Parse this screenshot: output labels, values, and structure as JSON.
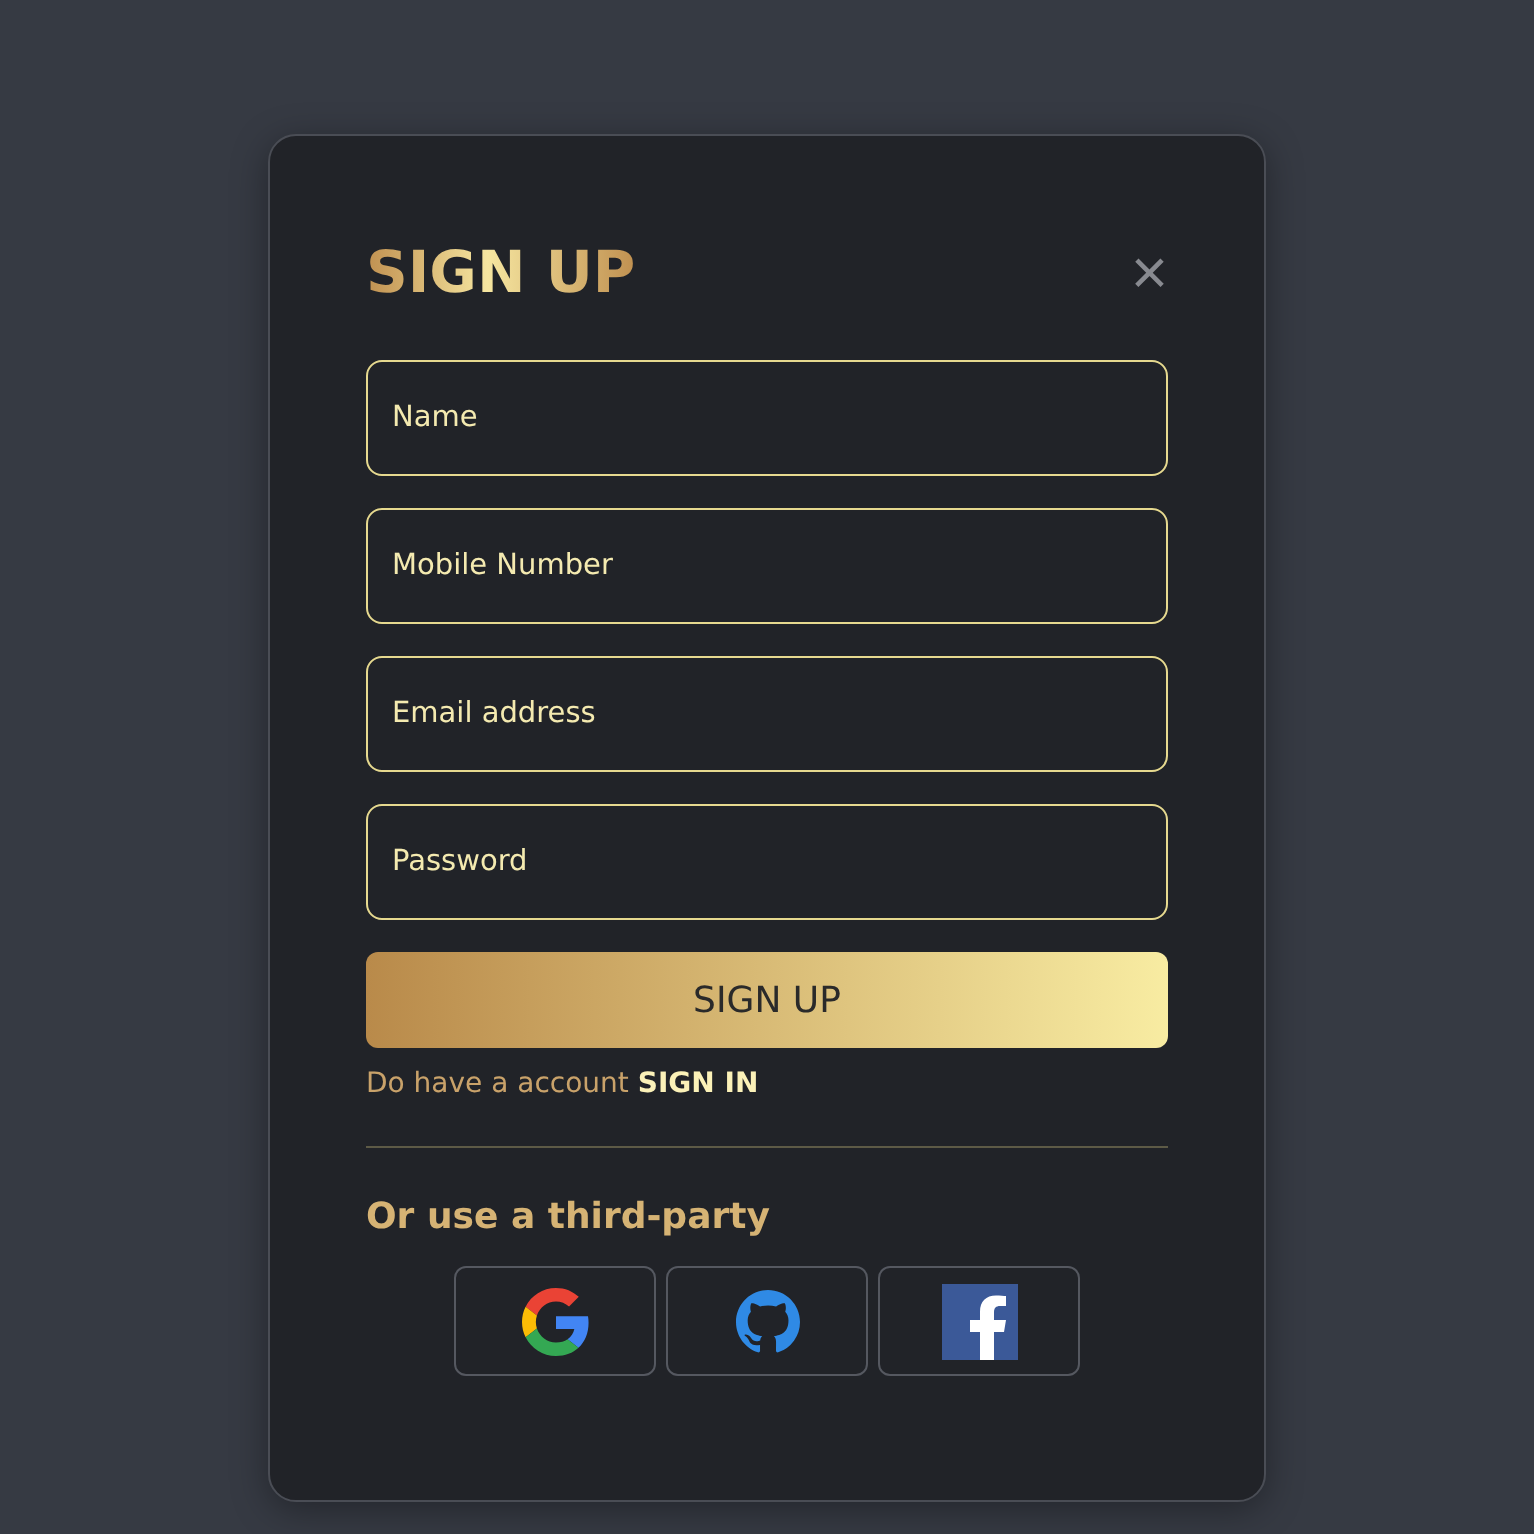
{
  "title": "SIGN UP",
  "close": "×",
  "fields": [
    {
      "placeholder": "Name"
    },
    {
      "placeholder": "Mobile Number"
    },
    {
      "placeholder": "Email address"
    },
    {
      "placeholder": "Password"
    }
  ],
  "submit": "SIGN UP",
  "signin": {
    "prompt": "Do have a account",
    "link": "SIGN IN"
  },
  "third_party": {
    "heading": "Or use a third-party",
    "providers": [
      {
        "kind": "google"
      },
      {
        "kind": "github"
      },
      {
        "kind": "facebook"
      }
    ]
  }
}
